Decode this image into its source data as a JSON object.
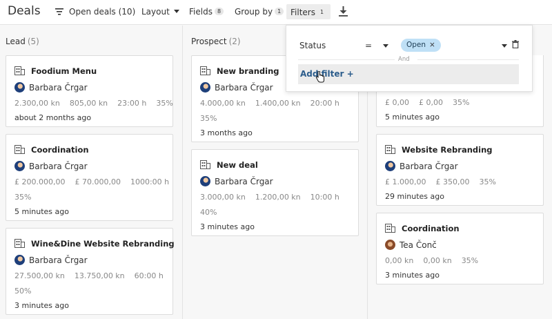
{
  "toolbar": {
    "title": "Deals",
    "open_deals": "Open deals (10)",
    "layout": "Layout",
    "fields": "Fields",
    "fields_count": "8",
    "group_by": "Group by",
    "group_by_count": "1",
    "filters": "Filters",
    "filters_count": "1"
  },
  "columns": [
    {
      "name": "Lead",
      "count": "(5)",
      "cards": [
        {
          "title": "Foodium Menu",
          "owner": "Barbara Črgar",
          "meta": [
            "2.300,00 kn",
            "805,00 kn",
            "23:00 h",
            "35%"
          ],
          "ago": "about 2 months ago"
        },
        {
          "title": "Coordination",
          "owner": "Barbara Črgar",
          "meta": [
            "£ 200.000,00",
            "£ 70.000,00",
            "1000:00 h"
          ],
          "meta2": "35%",
          "ago": "5 minutes ago"
        },
        {
          "title": "Wine&Dine Website Rebranding",
          "owner": "Barbara Črgar",
          "meta": [
            "27.500,00 kn",
            "13.750,00 kn",
            "60:00 h"
          ],
          "meta2": "50%",
          "ago": "3 minutes ago"
        }
      ]
    },
    {
      "name": "Prospect",
      "count": "(2)",
      "cards": [
        {
          "title": "New branding",
          "owner": "Barbara Črgar",
          "meta": [
            "4.000,00 kn",
            "1.400,00 kn",
            "20:00 h"
          ],
          "meta2": "35%",
          "ago": "3 months ago"
        },
        {
          "title": "New deal",
          "owner": "Barbara Črgar",
          "meta": [
            "3.000,00 kn",
            "1.200,00 kn",
            "10:00 h"
          ],
          "meta2": "40%",
          "ago": "3 minutes ago"
        }
      ]
    },
    {
      "name": "",
      "count": "",
      "cards": [
        {
          "title": "",
          "owner": "",
          "meta": [
            "£ 0,00",
            "£ 0,00",
            "35%"
          ],
          "ago": "5 minutes ago"
        },
        {
          "title": "Website Rebranding",
          "owner": "Barbara Črgar",
          "meta": [
            "£ 1.000,00",
            "£ 350,00",
            "35%"
          ],
          "ago": "29 minutes ago"
        },
        {
          "title": "Coordination",
          "owner": "Tea Čonč",
          "meta": [
            "0,00 kn",
            "0,00 kn",
            "35%"
          ],
          "ago": "3 minutes ago"
        }
      ]
    }
  ],
  "filter_popup": {
    "field": "Status",
    "operator": "=",
    "value": "Open",
    "value_remove": "×",
    "and_label": "And",
    "add_filter": "Add filter +"
  }
}
